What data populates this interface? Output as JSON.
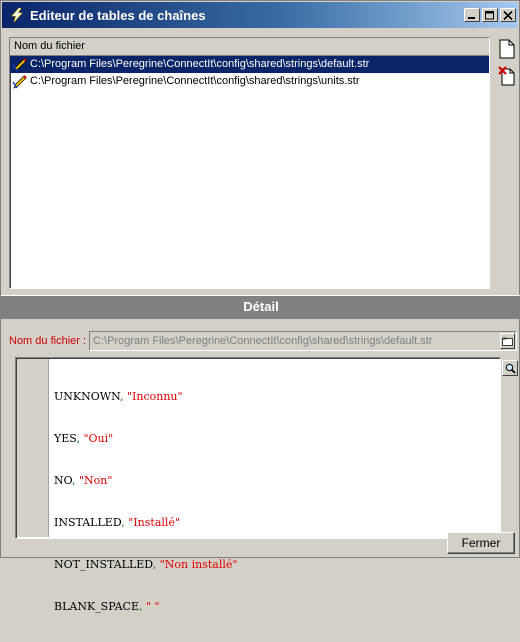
{
  "window": {
    "title": "Editeur de tables de chaînes",
    "icon": "lightning-icon",
    "controls": [
      "minimize-icon",
      "maximize-icon",
      "close-icon"
    ]
  },
  "file_list": {
    "header": "Nom du fichier",
    "rows": [
      {
        "path": "C:\\Program Files\\Peregrine\\ConnectIt\\config\\shared\\strings\\default.str",
        "selected": true
      },
      {
        "path": "C:\\Program Files\\Peregrine\\ConnectIt\\config\\shared\\strings\\units.str",
        "selected": false
      }
    ],
    "side_buttons": [
      "new-file-icon",
      "delete-file-icon"
    ]
  },
  "detail": {
    "title": "Détail",
    "filename_label": "Nom du fichier :",
    "filename_value": "C:\\Program Files\\Peregrine\\ConnectIt\\config\\shared\\strings\\default.str",
    "lines": [
      {
        "key": "UNKNOWN",
        "value": "\"Inconnu\""
      },
      {
        "key": "YES",
        "value": "\"Oui\""
      },
      {
        "key": "NO",
        "value": "\"Non\""
      },
      {
        "key": "INSTALLED",
        "value": "\"Installé\""
      },
      {
        "key": "NOT_INSTALLED",
        "value": "\"Non installé\""
      },
      {
        "key": "BLANK_SPACE",
        "value": "\" \""
      }
    ]
  },
  "footer": {
    "close_label": "Fermer"
  },
  "colors": {
    "title_gradient_start": "#0a246a",
    "selection": "#0a246a",
    "label_red": "#cc0000",
    "string_red": "#e00000",
    "separator_green": "#008000"
  }
}
